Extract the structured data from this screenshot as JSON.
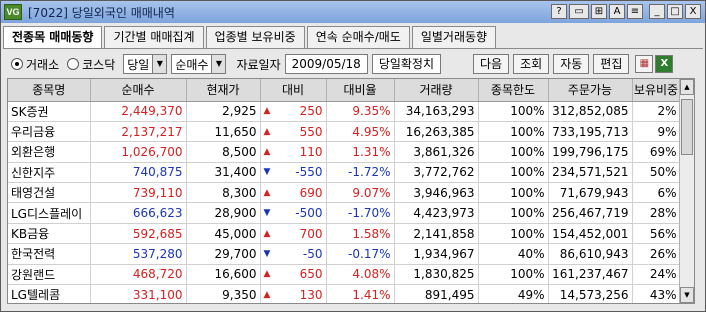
{
  "window": {
    "app_icon": "VG",
    "title": "[7022] 당일외국인 매매내역",
    "title_buttons": [
      "?",
      "▭",
      "⊞",
      "A",
      "≡",
      "_",
      "□",
      "X"
    ]
  },
  "tabs": [
    {
      "label": "전종목 매매동향"
    },
    {
      "label": "기간별 매매집계"
    },
    {
      "label": "업종별 보유비중"
    },
    {
      "label": "연속 순매수/매도"
    },
    {
      "label": "일별거래동향"
    }
  ],
  "toolbar": {
    "radio_exchange": "거래소",
    "radio_kosdaq": "코스닥",
    "period_select": "당일",
    "sort_select": "순매수",
    "date_label": "자료일자",
    "date_value": "2009/05/18",
    "confirm_status": "당일확정치",
    "btn_next": "다음",
    "btn_query": "조회",
    "btn_auto": "자동",
    "btn_edit": "편집",
    "grid_icon": "grid-icon",
    "excel_icon": "excel-icon"
  },
  "table": {
    "headers": [
      "종목명",
      "순매수",
      "현재가",
      "대비",
      "대비율",
      "거래량",
      "종목한도",
      "주문가능",
      "보유비중"
    ],
    "rows": [
      {
        "name": "SK증권",
        "net": "2,449,370",
        "price": "2,925",
        "dir": "up",
        "change": "250",
        "rate": "9.35%",
        "volume": "34,163,293",
        "limit": "100%",
        "orderable": "312,852,085",
        "hold": "2%"
      },
      {
        "name": "우리금융",
        "net": "2,137,217",
        "price": "11,650",
        "dir": "up",
        "change": "550",
        "rate": "4.95%",
        "volume": "16,263,385",
        "limit": "100%",
        "orderable": "733,195,713",
        "hold": "9%"
      },
      {
        "name": "외환은행",
        "net": "1,026,700",
        "price": "8,500",
        "dir": "up",
        "change": "110",
        "rate": "1.31%",
        "volume": "3,861,326",
        "limit": "100%",
        "orderable": "199,796,175",
        "hold": "69%"
      },
      {
        "name": "신한지주",
        "net": "740,875",
        "price": "31,400",
        "dir": "down",
        "change": "-550",
        "rate": "-1.72%",
        "volume": "3,772,762",
        "limit": "100%",
        "orderable": "234,571,521",
        "hold": "50%"
      },
      {
        "name": "태영건설",
        "net": "739,110",
        "price": "8,300",
        "dir": "up",
        "change": "690",
        "rate": "9.07%",
        "volume": "3,946,963",
        "limit": "100%",
        "orderable": "71,679,943",
        "hold": "6%"
      },
      {
        "name": "LG디스플레이",
        "net": "666,623",
        "price": "28,900",
        "dir": "down",
        "change": "-500",
        "rate": "-1.70%",
        "volume": "4,423,973",
        "limit": "100%",
        "orderable": "256,467,719",
        "hold": "28%"
      },
      {
        "name": "KB금융",
        "net": "592,685",
        "price": "45,000",
        "dir": "up",
        "change": "700",
        "rate": "1.58%",
        "volume": "2,141,858",
        "limit": "100%",
        "orderable": "154,452,001",
        "hold": "56%"
      },
      {
        "name": "한국전력",
        "net": "537,280",
        "price": "29,700",
        "dir": "down",
        "change": "-50",
        "rate": "-0.17%",
        "volume": "1,934,967",
        "limit": "40%",
        "orderable": "86,610,943",
        "hold": "26%"
      },
      {
        "name": "강원랜드",
        "net": "468,720",
        "price": "16,600",
        "dir": "up",
        "change": "650",
        "rate": "4.08%",
        "volume": "1,830,825",
        "limit": "100%",
        "orderable": "161,237,467",
        "hold": "24%"
      },
      {
        "name": "LG텔레콤",
        "net": "331,100",
        "price": "9,350",
        "dir": "up",
        "change": "130",
        "rate": "1.41%",
        "volume": "891,495",
        "limit": "49%",
        "orderable": "14,573,256",
        "hold": "43%"
      }
    ]
  },
  "colors": {
    "up": "#d42020",
    "down": "#1a35b8",
    "header_bg": "#dcdcdc"
  }
}
